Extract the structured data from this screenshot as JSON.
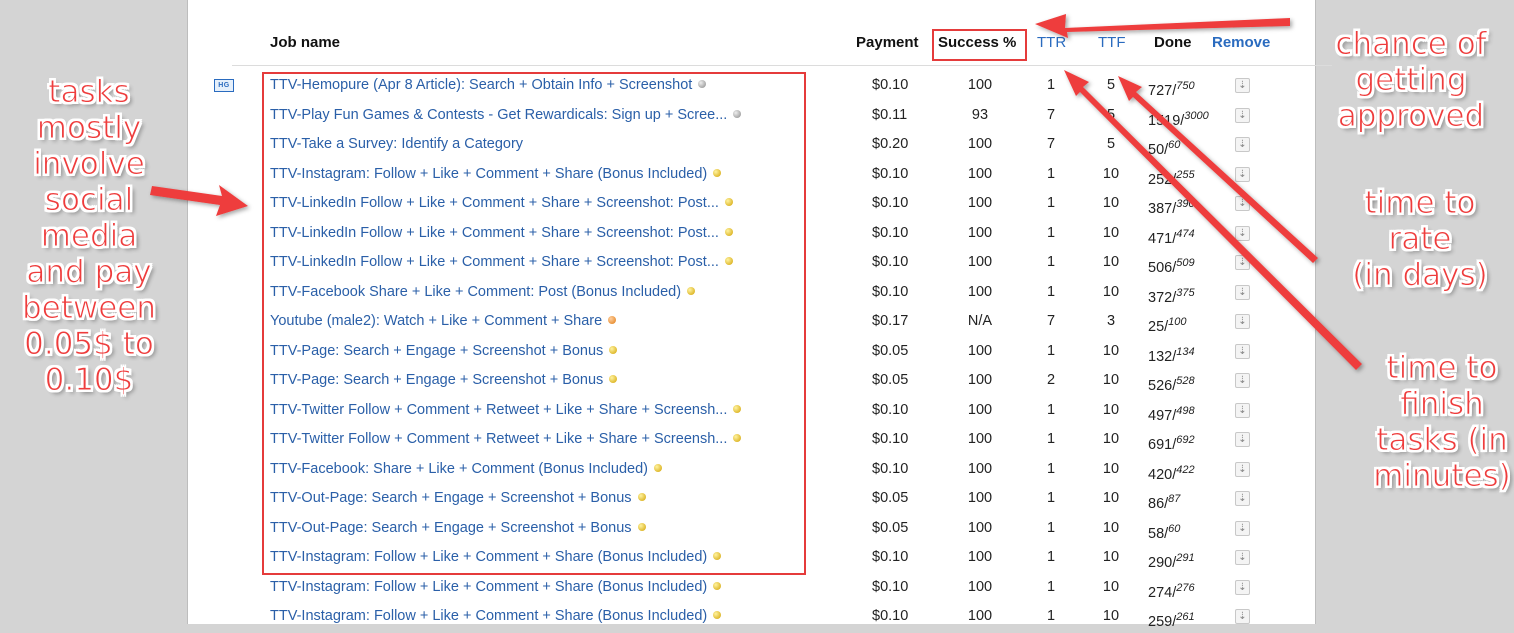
{
  "colors": {
    "accent_link": "#2a5fa8",
    "annotation_red": "#ee3c3c"
  },
  "headers": {
    "job_name": "Job name",
    "payment": "Payment",
    "success": "Success %",
    "ttr": "TTR",
    "ttf": "TTF",
    "done": "Done",
    "remove": "Remove"
  },
  "badge": "HG",
  "rows": [
    {
      "name": "TTV-Hemopure (Apr 8 Article): Search + Obtain Info + Screenshot",
      "dot": "gray",
      "pay": "$0.10",
      "success": "100",
      "ttr": "1",
      "ttf": "5",
      "done": "727",
      "total": "750"
    },
    {
      "name": "TTV-Play Fun Games & Contests - Get Rewardicals: Sign up + Scree...",
      "dot": "gray",
      "pay": "$0.11",
      "success": "93",
      "ttr": "7",
      "ttf": "5",
      "done": "1519",
      "total": "3000"
    },
    {
      "name": "TTV-Take a Survey: Identify a Category",
      "dot": "none",
      "pay": "$0.20",
      "success": "100",
      "ttr": "7",
      "ttf": "5",
      "done": "50",
      "total": "60"
    },
    {
      "name": "TTV-Instagram: Follow + Like + Comment + Share (Bonus Included)",
      "dot": "yellow",
      "pay": "$0.10",
      "success": "100",
      "ttr": "1",
      "ttf": "10",
      "done": "252",
      "total": "255"
    },
    {
      "name": "TTV-LinkedIn Follow + Like + Comment + Share + Screenshot: Post...",
      "dot": "yellow",
      "pay": "$0.10",
      "success": "100",
      "ttr": "1",
      "ttf": "10",
      "done": "387",
      "total": "390"
    },
    {
      "name": "TTV-LinkedIn Follow + Like + Comment + Share + Screenshot: Post...",
      "dot": "yellow",
      "pay": "$0.10",
      "success": "100",
      "ttr": "1",
      "ttf": "10",
      "done": "471",
      "total": "474"
    },
    {
      "name": "TTV-LinkedIn Follow + Like + Comment + Share + Screenshot: Post...",
      "dot": "yellow",
      "pay": "$0.10",
      "success": "100",
      "ttr": "1",
      "ttf": "10",
      "done": "506",
      "total": "509"
    },
    {
      "name": "TTV-Facebook Share + Like + Comment: Post (Bonus Included)",
      "dot": "yellow",
      "pay": "$0.10",
      "success": "100",
      "ttr": "1",
      "ttf": "10",
      "done": "372",
      "total": "375"
    },
    {
      "name": "Youtube (male2): Watch + Like + Comment + Share",
      "dot": "orange",
      "pay": "$0.17",
      "success": "N/A",
      "ttr": "7",
      "ttf": "3",
      "done": "25",
      "total": "100"
    },
    {
      "name": "TTV-Page: Search + Engage + Screenshot + Bonus",
      "dot": "yellow",
      "pay": "$0.05",
      "success": "100",
      "ttr": "1",
      "ttf": "10",
      "done": "132",
      "total": "134"
    },
    {
      "name": "TTV-Page: Search + Engage + Screenshot + Bonus",
      "dot": "yellow",
      "pay": "$0.05",
      "success": "100",
      "ttr": "2",
      "ttf": "10",
      "done": "526",
      "total": "528"
    },
    {
      "name": "TTV-Twitter Follow + Comment + Retweet + Like + Share + Screensh...",
      "dot": "yellow",
      "pay": "$0.10",
      "success": "100",
      "ttr": "1",
      "ttf": "10",
      "done": "497",
      "total": "498"
    },
    {
      "name": "TTV-Twitter Follow + Comment + Retweet + Like + Share + Screensh...",
      "dot": "yellow",
      "pay": "$0.10",
      "success": "100",
      "ttr": "1",
      "ttf": "10",
      "done": "691",
      "total": "692"
    },
    {
      "name": "TTV-Facebook: Share + Like + Comment (Bonus Included)",
      "dot": "yellow",
      "pay": "$0.10",
      "success": "100",
      "ttr": "1",
      "ttf": "10",
      "done": "420",
      "total": "422"
    },
    {
      "name": "TTV-Out-Page: Search + Engage + Screenshot + Bonus",
      "dot": "yellow",
      "pay": "$0.05",
      "success": "100",
      "ttr": "1",
      "ttf": "10",
      "done": "86",
      "total": "87"
    },
    {
      "name": "TTV-Out-Page: Search + Engage + Screenshot + Bonus",
      "dot": "yellow",
      "pay": "$0.05",
      "success": "100",
      "ttr": "1",
      "ttf": "10",
      "done": "58",
      "total": "60"
    },
    {
      "name": "TTV-Instagram: Follow + Like + Comment + Share (Bonus Included)",
      "dot": "yellow",
      "pay": "$0.10",
      "success": "100",
      "ttr": "1",
      "ttf": "10",
      "done": "290",
      "total": "291"
    },
    {
      "name": "TTV-Instagram: Follow + Like + Comment + Share (Bonus Included)",
      "dot": "yellow",
      "pay": "$0.10",
      "success": "100",
      "ttr": "1",
      "ttf": "10",
      "done": "274",
      "total": "276"
    },
    {
      "name": "TTV-Instagram: Follow + Like + Comment + Share (Bonus Included)",
      "dot": "yellow",
      "pay": "$0.10",
      "success": "100",
      "ttr": "1",
      "ttf": "10",
      "done": "259",
      "total": "261"
    }
  ],
  "annotations": {
    "left_note": [
      "tasks",
      "mostly",
      "involve",
      "social",
      "media",
      "and pay",
      "between",
      "0.05$ to",
      "0.10$"
    ],
    "approved_note": [
      "chance of",
      "getting",
      "approved"
    ],
    "ttr_note": [
      "time to rate",
      "(in days)"
    ],
    "ttf_note": [
      "time to",
      "finish",
      "tasks (in",
      "minutes)"
    ]
  }
}
